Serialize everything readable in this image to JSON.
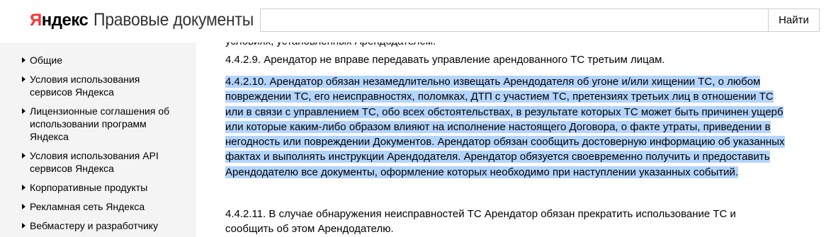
{
  "header": {
    "logo_first": "Я",
    "logo_rest": "ндекс",
    "title": "Правовые документы",
    "search_placeholder": "",
    "search_button": "Найти"
  },
  "sidebar": {
    "items": [
      {
        "label": "Общие"
      },
      {
        "label": "Условия использования сервисов Яндекса"
      },
      {
        "label": "Лицензионные соглашения об использовании программ Яндекса"
      },
      {
        "label": "Условия использования API сервисов Яндекса"
      },
      {
        "label": "Корпоративные продукты"
      },
      {
        "label": "Рекламная сеть Яндекса"
      },
      {
        "label": "Вебмастеру и разработчику"
      }
    ]
  },
  "content": {
    "cut_text": "условиях, установленных Арендодателем.",
    "p1": "4.4.2.9. Арендатор не вправе передавать управление арендованного ТС третьим лицам.",
    "p2": "4.4.2.10. Арендатор обязан незамедлительно извещать Арендодателя об угоне и/или хищении ТС, о любом повреждении ТС, его неисправностях, поломках, ДТП с участием ТС, претензиях третьих лиц в отношении ТС или в связи с управлением ТС, обо всех обстоятельствах, в результате которых ТС может быть причинен ущерб или которые каким-либо образом влияют на исполнение настоящего Договора, о факте утраты, приведении в негодность или повреждении Документов. Арендатор обязан сообщить достоверную информацию об указанных фактах и выполнять инструкции Арендодателя. Арендатор обязуется своевременно получить и предоставить Арендодателю все документы, оформление которых необходимо при наступлении указанных событий.",
    "p3": "4.4.2.11. В случае обнаружения неисправностей ТС Арендатор обязан прекратить использование ТС и сообщить об этом Арендодателю.",
    "highlight_color": "#b3d4fc"
  }
}
